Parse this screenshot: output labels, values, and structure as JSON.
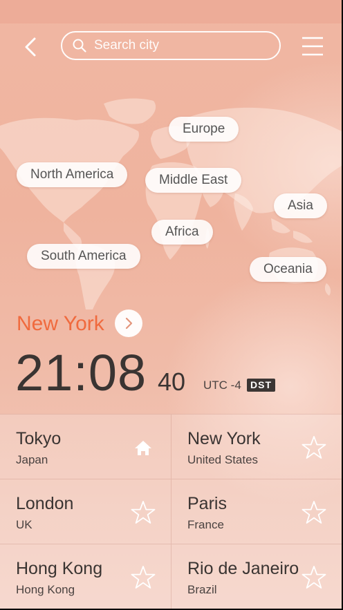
{
  "header": {
    "search_placeholder": "Search city",
    "icons": {
      "back": "chevron-left-icon",
      "search": "search-icon",
      "menu": "menu-icon"
    }
  },
  "regions": [
    "Europe",
    "North America",
    "Middle East",
    "Asia",
    "Africa",
    "South America",
    "Oceania"
  ],
  "selected_city": {
    "name": "New York",
    "time": "21:08",
    "seconds": "40",
    "utc_offset": "UTC -4",
    "dst_badge": "DST"
  },
  "cities": [
    {
      "name": "Tokyo",
      "country": "Japan",
      "icon": "home-icon"
    },
    {
      "name": "New York",
      "country": "United States",
      "icon": "star-icon"
    },
    {
      "name": "London",
      "country": "UK",
      "icon": "star-icon"
    },
    {
      "name": "Paris",
      "country": "France",
      "icon": "star-icon"
    },
    {
      "name": "Hong Kong",
      "country": "Hong Kong",
      "icon": "star-icon"
    },
    {
      "name": "Rio de Janeiro",
      "country": "Brazil",
      "icon": "star-icon"
    }
  ],
  "colors": {
    "accent": "#f06a3e",
    "background": "#f0b7a3",
    "text": "#3a3432"
  }
}
